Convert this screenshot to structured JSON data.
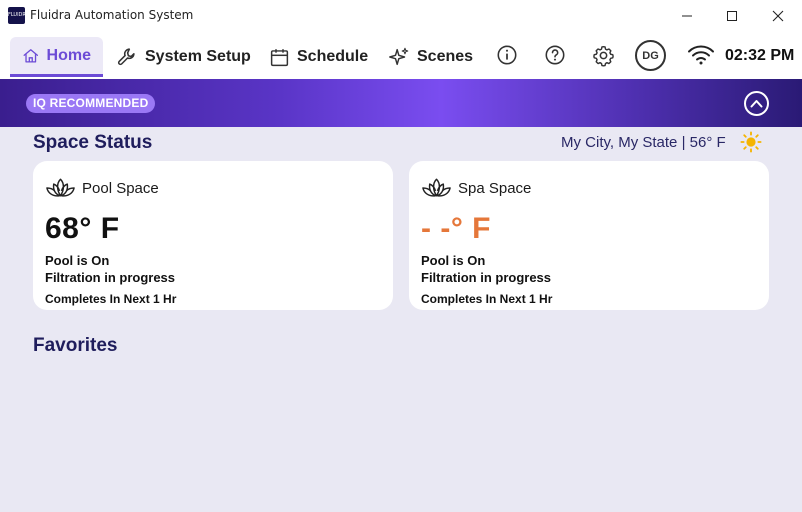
{
  "window": {
    "title": "Fluidra Automation System",
    "logo_text": "FLUIDRA"
  },
  "nav": {
    "tabs": [
      {
        "label": "Home",
        "icon": "home-icon",
        "active": true
      },
      {
        "label": "System Setup",
        "icon": "wrench-icon",
        "active": false
      },
      {
        "label": "Schedule",
        "icon": "calendar-icon",
        "active": false
      },
      {
        "label": "Scenes",
        "icon": "sparkle-icon",
        "active": false
      }
    ],
    "avatar_initials": "DG",
    "time": "02:32 PM"
  },
  "banner": {
    "pill_label": "IQ RECOMMENDED"
  },
  "space_status": {
    "title": "Space Status",
    "location": "My City, My State | 56° F",
    "cards": [
      {
        "name": "Pool Space",
        "temperature": "68° F",
        "status": "Pool is On",
        "activity": "Filtration in progress",
        "completion": "Completes In Next 1 Hr"
      },
      {
        "name": "Spa Space",
        "temperature": "- -° F",
        "status": "Pool is On",
        "activity": "Filtration in progress",
        "completion": "Completes In Next 1 Hr"
      }
    ]
  },
  "favorites": {
    "title": "Favorites"
  },
  "colors": {
    "accent": "#6c4bd6",
    "heading": "#1f1d5c",
    "missing_temp": "#e5773a",
    "background": "#e9e8f3"
  }
}
